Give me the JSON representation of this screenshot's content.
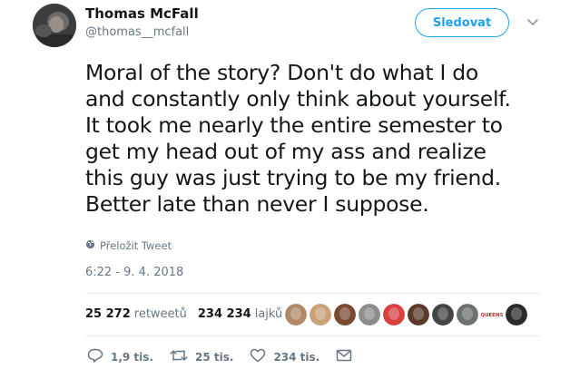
{
  "author": {
    "name": "Thomas McFall",
    "handle": "@thomas__mcfall"
  },
  "follow_button": {
    "label": "Sledovat"
  },
  "tweet": {
    "lines": [
      "Moral of the story? Don't do what I do",
      "and constantly only think about yourself.",
      "It took me nearly the entire semester to",
      "get my head out of my ass and realize",
      "this guy was just trying to be my friend.",
      "Better late than never I suppose."
    ]
  },
  "translate": {
    "label": "Přeložit Tweet"
  },
  "timestamp": "6:22 - 9. 4. 2018",
  "stats": {
    "retweets_count": "25 272",
    "retweets_label": "retweetů",
    "likes_count": "234 234",
    "likes_label": "lajků"
  },
  "likers": [
    {
      "icon": "avatar",
      "color": "#b08a68"
    },
    {
      "icon": "avatar",
      "color": "#c9a27a"
    },
    {
      "icon": "avatar",
      "color": "#7a4b32"
    },
    {
      "icon": "avatar",
      "color": "#8c8c8c"
    },
    {
      "icon": "avatar",
      "color": "#d94040"
    },
    {
      "icon": "avatar",
      "color": "#5a3a2a"
    },
    {
      "icon": "avatar",
      "color": "#444444"
    },
    {
      "icon": "avatar",
      "color": "#6b7070"
    },
    {
      "icon": "avatar-text",
      "color": "#c6282b",
      "text": "QUEENS"
    },
    {
      "icon": "avatar",
      "color": "#2a2a2a"
    }
  ],
  "actions": {
    "replies": "1,9 tis.",
    "retweets": "25 tis.",
    "likes": "234 tis."
  },
  "colors": {
    "accent": "#1da1f2",
    "secondary_text": "#657786",
    "divider": "#e6ecf0"
  }
}
